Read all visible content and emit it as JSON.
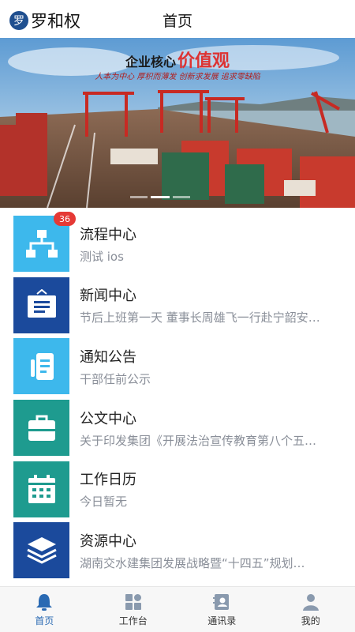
{
  "header": {
    "avatar_char": "罗",
    "user_name": "罗和权",
    "title": "首页"
  },
  "banner": {
    "slogan_main": "企业核心",
    "slogan_accent": "价值观",
    "slogan_sub": "人本为中心  厚积而薄发  创新求发展  追求零缺陷",
    "slide_count": 3,
    "active_slide": 2
  },
  "menu": [
    {
      "title": "流程中心",
      "subtitle": "测试 ios",
      "icon": "flowchart-icon",
      "color": "#3db8ec",
      "badge": "36"
    },
    {
      "title": "新闻中心",
      "subtitle": "节后上班第一天 董事长周雄飞一行赴宁韶安…",
      "icon": "news-board-icon",
      "color": "#1b4a9c"
    },
    {
      "title": "通知公告",
      "subtitle": "干部任前公示",
      "icon": "notice-document-icon",
      "color": "#3db8ec"
    },
    {
      "title": "公文中心",
      "subtitle": "关于印发集团《开展法治宣传教育第八个五…",
      "icon": "briefcase-icon",
      "color": "#1e9b8f"
    },
    {
      "title": "工作日历",
      "subtitle": "今日暂无",
      "icon": "calendar-icon",
      "color": "#1e9b8f"
    },
    {
      "title": "资源中心",
      "subtitle": "湖南交水建集团发展战略暨“十四五”规划…",
      "icon": "layers-icon",
      "color": "#1b4a9c"
    }
  ],
  "tabs": [
    {
      "label": "首页",
      "icon": "bell-icon",
      "active": true
    },
    {
      "label": "工作台",
      "icon": "grid-icon",
      "active": false
    },
    {
      "label": "通讯录",
      "icon": "contacts-icon",
      "active": false
    },
    {
      "label": "我的",
      "icon": "person-icon",
      "active": false
    }
  ],
  "colors": {
    "accent": "#2a6ab3",
    "inactive_icon": "#8a9aae"
  }
}
